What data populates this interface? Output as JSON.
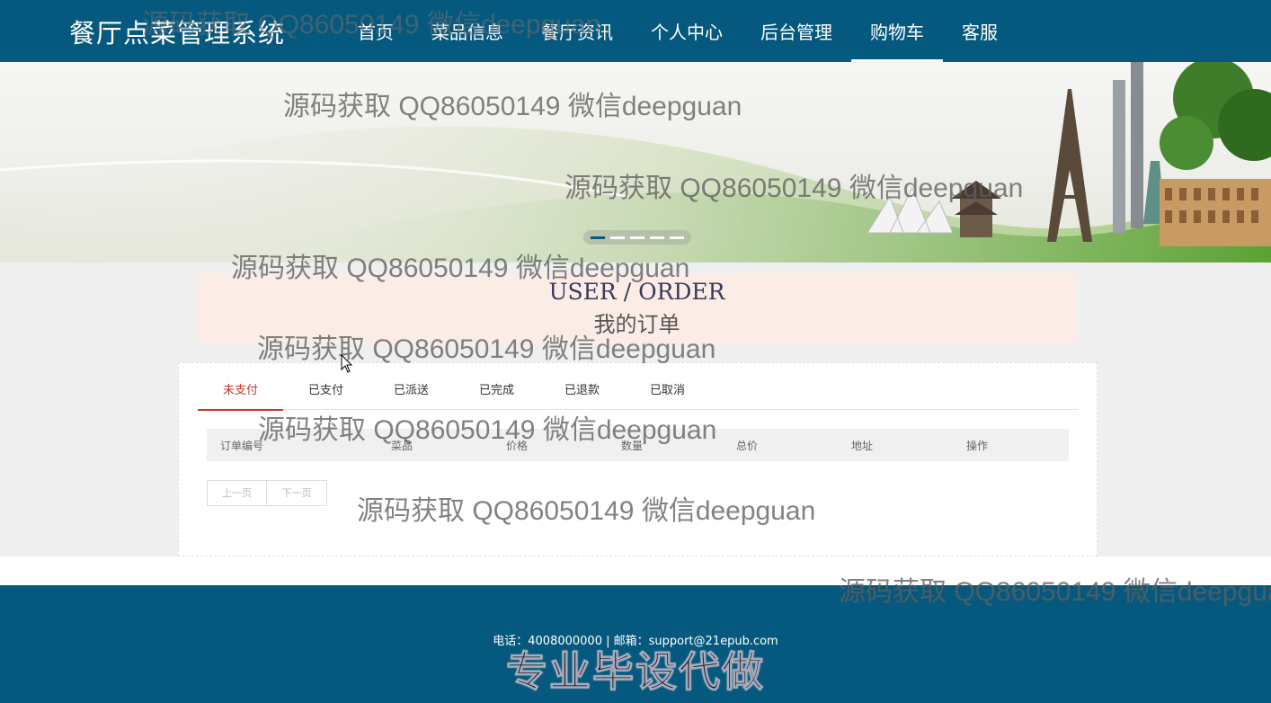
{
  "header": {
    "brand": "餐厅点菜管理系统",
    "nav": [
      {
        "label": "首页",
        "active": false
      },
      {
        "label": "菜品信息",
        "active": false
      },
      {
        "label": "餐厅资讯",
        "active": false
      },
      {
        "label": "个人中心",
        "active": false
      },
      {
        "label": "后台管理",
        "active": false
      },
      {
        "label": "购物车",
        "active": true
      },
      {
        "label": "客服",
        "active": false
      }
    ]
  },
  "banner": {
    "active_slide": 1,
    "slide_count": 5
  },
  "page_title": {
    "en": "USER / ORDER",
    "zh": "我的订单"
  },
  "order_tabs": [
    {
      "label": "未支付",
      "active": true
    },
    {
      "label": "已支付",
      "active": false
    },
    {
      "label": "已派送",
      "active": false
    },
    {
      "label": "已完成",
      "active": false
    },
    {
      "label": "已退款",
      "active": false
    },
    {
      "label": "已取消",
      "active": false
    }
  ],
  "table": {
    "columns": [
      "订单编号",
      "菜品",
      "价格",
      "数量",
      "总价",
      "地址",
      "操作"
    ],
    "rows": []
  },
  "pager": {
    "prev": "上一页",
    "next": "下一页"
  },
  "footer": {
    "contact": "电话：4008000000 | 邮箱：support@21epub.com",
    "promo": "专业毕设代做"
  },
  "watermark": "源码获取 QQ86050149 微信deepguan",
  "colors": {
    "primary": "#05597e",
    "active_tab": "#c0392b",
    "title_band": "#fbece6"
  }
}
